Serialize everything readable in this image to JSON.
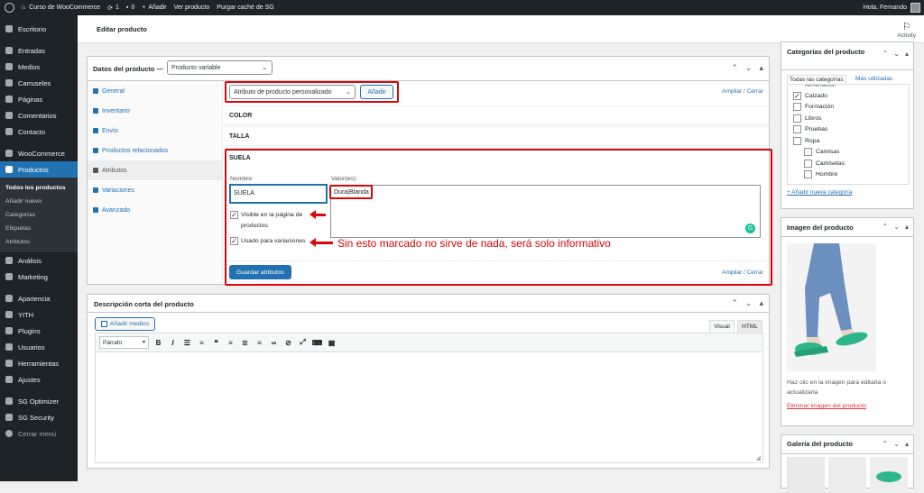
{
  "admin_bar": {
    "site_name": "Curso de WooCommerce",
    "updates": "1",
    "comments": "0",
    "add_new": "Añadir",
    "view_product": "Ver producto",
    "purge_cache": "Purgar caché de SG",
    "greeting": "Hola, Fernando"
  },
  "sidebar": {
    "items_top": [
      {
        "label": "Escritorio",
        "icon": "dashboard-icon"
      },
      {
        "label": "Entradas",
        "icon": "pin-icon"
      },
      {
        "label": "Medios",
        "icon": "media-icon"
      },
      {
        "label": "Carruseles",
        "icon": "carousel-icon"
      },
      {
        "label": "Páginas",
        "icon": "page-icon"
      },
      {
        "label": "Comentarios",
        "icon": "comment-icon"
      },
      {
        "label": "Contacto",
        "icon": "mail-icon"
      },
      {
        "label": "WooCommerce",
        "icon": "woo-icon"
      },
      {
        "label": "Productos",
        "icon": "product-icon"
      }
    ],
    "submenu": [
      "Todos los productos",
      "Añadir nuevo",
      "Categorías",
      "Etiquetas",
      "Atributos"
    ],
    "items_bottom": [
      {
        "label": "Análisis",
        "icon": "chart-icon"
      },
      {
        "label": "Marketing",
        "icon": "megaphone-icon"
      },
      {
        "label": "Apariencia",
        "icon": "brush-icon"
      },
      {
        "label": "YITH",
        "icon": "yith-icon"
      },
      {
        "label": "Plugins",
        "icon": "plugin-icon"
      },
      {
        "label": "Usuarios",
        "icon": "users-icon"
      },
      {
        "label": "Herramientas",
        "icon": "tools-icon"
      },
      {
        "label": "Ajustes",
        "icon": "settings-icon"
      },
      {
        "label": "SG Optimizer",
        "icon": "sg-icon"
      },
      {
        "label": "SG Security",
        "icon": "shield-icon"
      },
      {
        "label": "Cerrar menú",
        "icon": "collapse-icon"
      }
    ]
  },
  "header": {
    "title": "Editar producto",
    "activity": "Activity"
  },
  "product_data": {
    "title": "Datos del producto —",
    "type_selected": "Producto variable",
    "tabs": [
      "General",
      "Inventario",
      "Envío",
      "Productos relacionados",
      "Atributos",
      "Variaciones",
      "Avanzado"
    ],
    "active_tab": "Atributos",
    "attribute_select": "Atributo de producto personalizado",
    "add_button": "Añadir",
    "expand_collapse": "Ampliar / Cerrar",
    "attributes": [
      "COLOR",
      "TALLA",
      "SUELA"
    ],
    "name_label": "Nombre:",
    "name_value": "SUELA",
    "values_label": "Valor(es):",
    "values_value": "Dura|Blanda",
    "visible_label": "Visible en la página de productos",
    "variations_label": "Usado para variaciones",
    "save_button": "Guardar atributos",
    "annotation": "Sin esto marcado no sirve de nada, será solo informativo"
  },
  "short_description": {
    "title": "Descripción corta del producto",
    "add_media": "Añadir medios",
    "tab_visual": "Visual",
    "tab_html": "HTML",
    "format": "Párrafo"
  },
  "categories": {
    "title": "Categorías del producto",
    "tab_all": "Todas las categorías",
    "tab_used": "Más utilizadas",
    "partial_top": "Alimentación",
    "items": [
      {
        "label": "Calzado",
        "checked": true,
        "indent": 0
      },
      {
        "label": "Formación",
        "checked": false,
        "indent": 0
      },
      {
        "label": "Libros",
        "checked": false,
        "indent": 0
      },
      {
        "label": "Pruebas",
        "checked": false,
        "indent": 0
      },
      {
        "label": "Ropa",
        "checked": false,
        "indent": 0
      },
      {
        "label": "Camisas",
        "checked": false,
        "indent": 1
      },
      {
        "label": "Camisetas",
        "checked": false,
        "indent": 1
      },
      {
        "label": "Hombre",
        "checked": false,
        "indent": 1
      }
    ],
    "add_new": "+ Añadir nueva categoría"
  },
  "product_image": {
    "title": "Imagen del producto",
    "hint": "Haz clic en la imagen para editarla o actualizarla",
    "remove": "Eliminar imagen del producto"
  },
  "gallery": {
    "title": "Galería del producto"
  },
  "colors": {
    "accent": "#2271b1",
    "annotation_red": "#d9060a",
    "admin_dark": "#1d2327",
    "shoe_green": "#2fb58a"
  }
}
